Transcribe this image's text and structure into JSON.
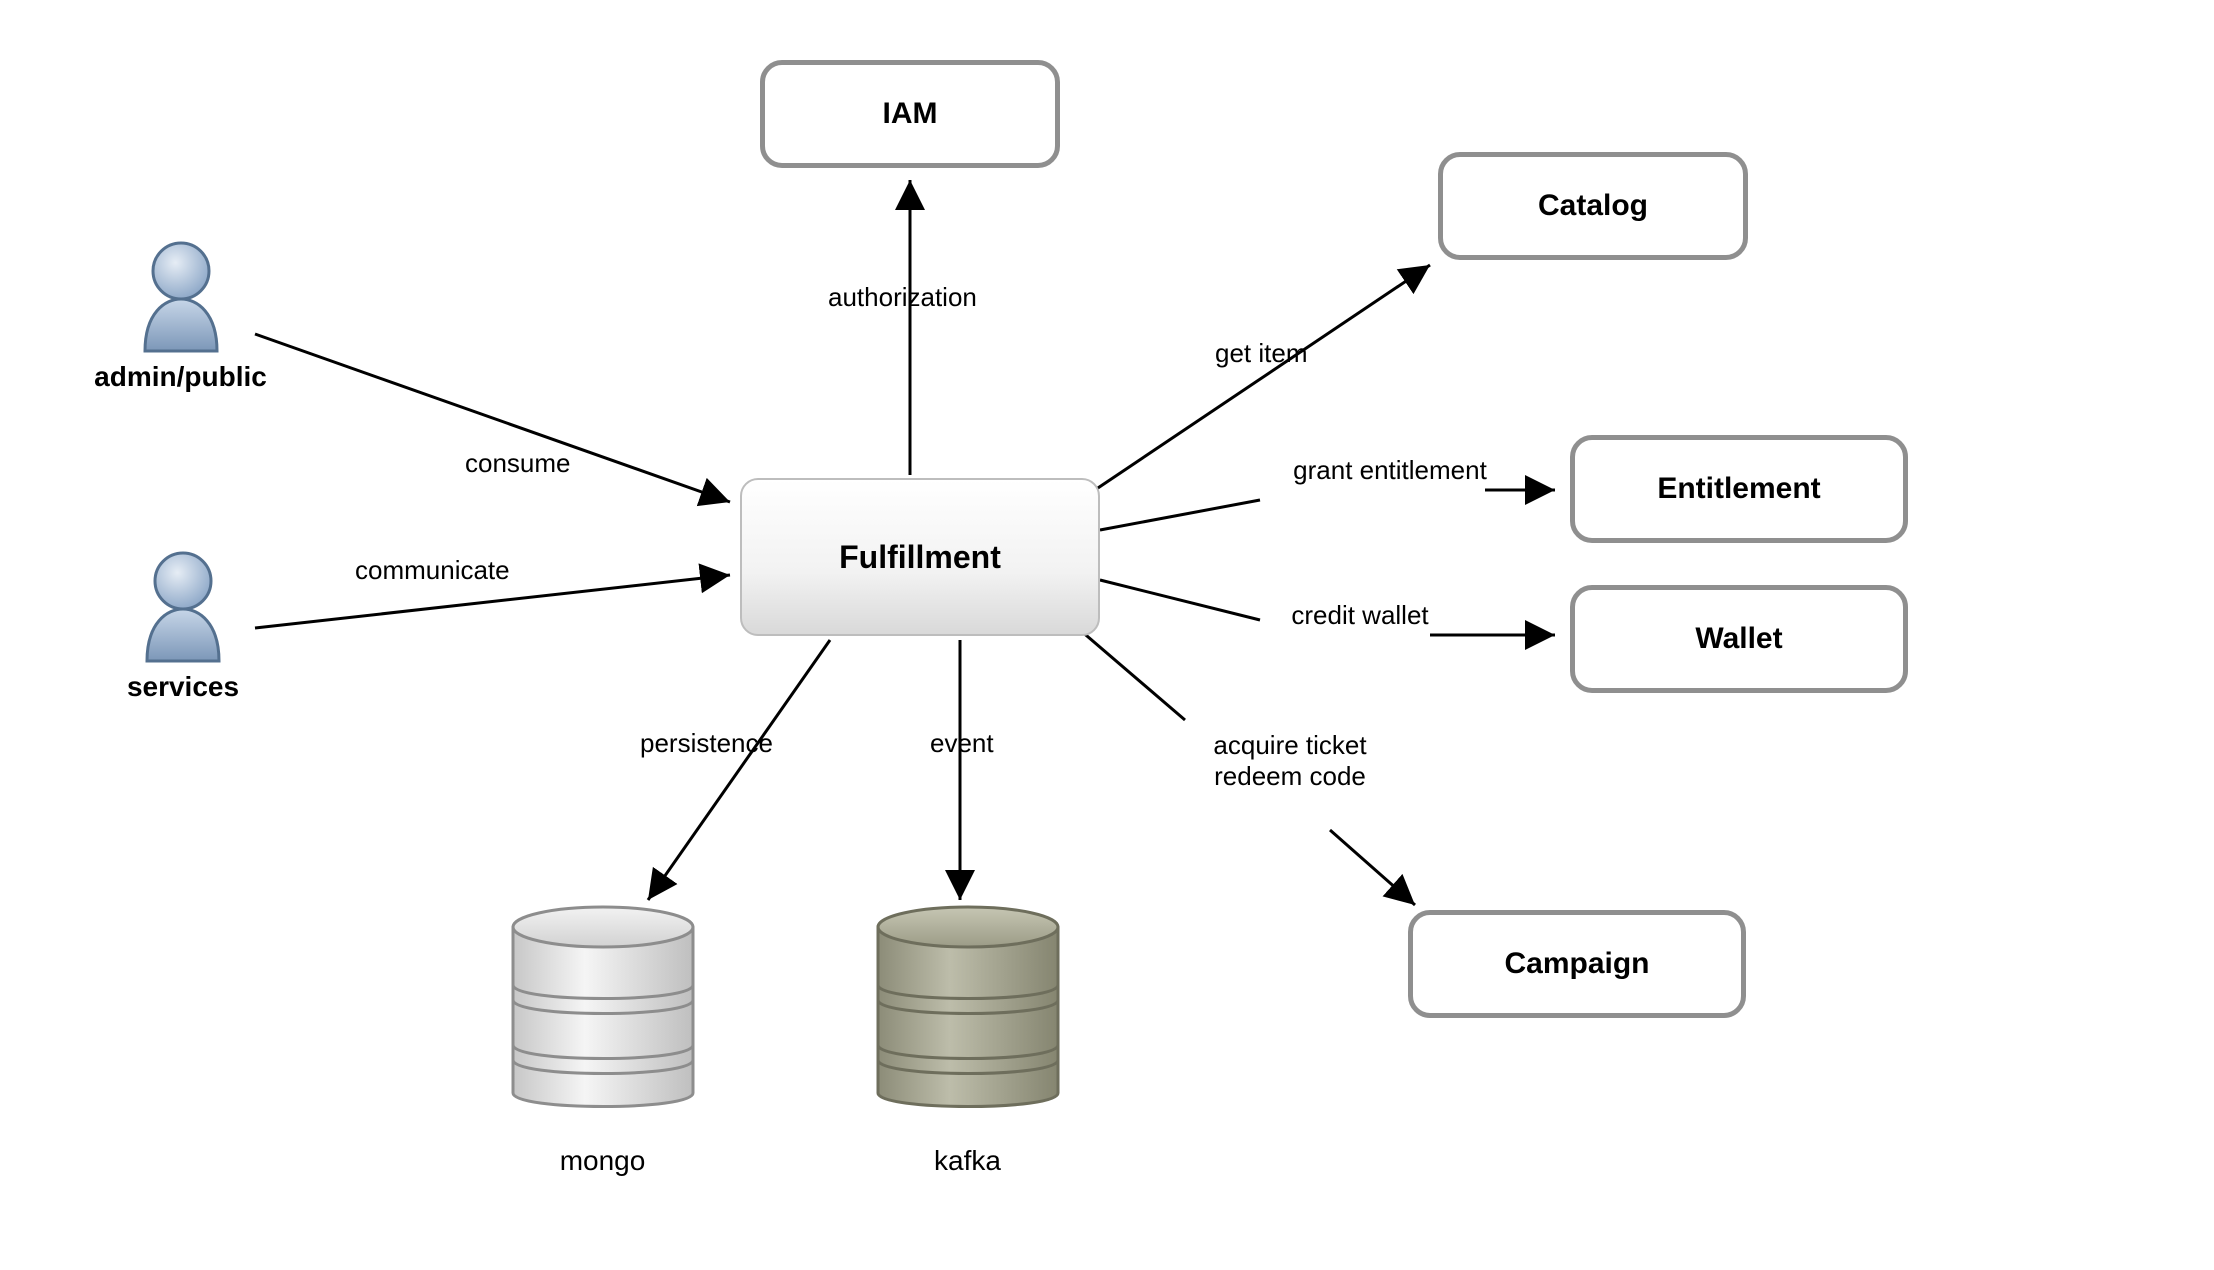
{
  "nodes": {
    "fulfillment": "Fulfillment",
    "iam": "IAM",
    "catalog": "Catalog",
    "entitlement": "Entitlement",
    "wallet": "Wallet",
    "campaign": "Campaign"
  },
  "actors": {
    "admin_public": "admin/public",
    "services": "services"
  },
  "databases": {
    "mongo": "mongo",
    "kafka": "kafka"
  },
  "edges": {
    "consume": "consume",
    "communicate": "communicate",
    "authorization": "authorization",
    "persistence": "persistence",
    "event": "event",
    "get_item": "get item",
    "grant_entitlement": "grant\nentitlement",
    "credit_wallet": "credit\nwallet",
    "acquire_redeem": "acquire ticket\nredeem code"
  }
}
